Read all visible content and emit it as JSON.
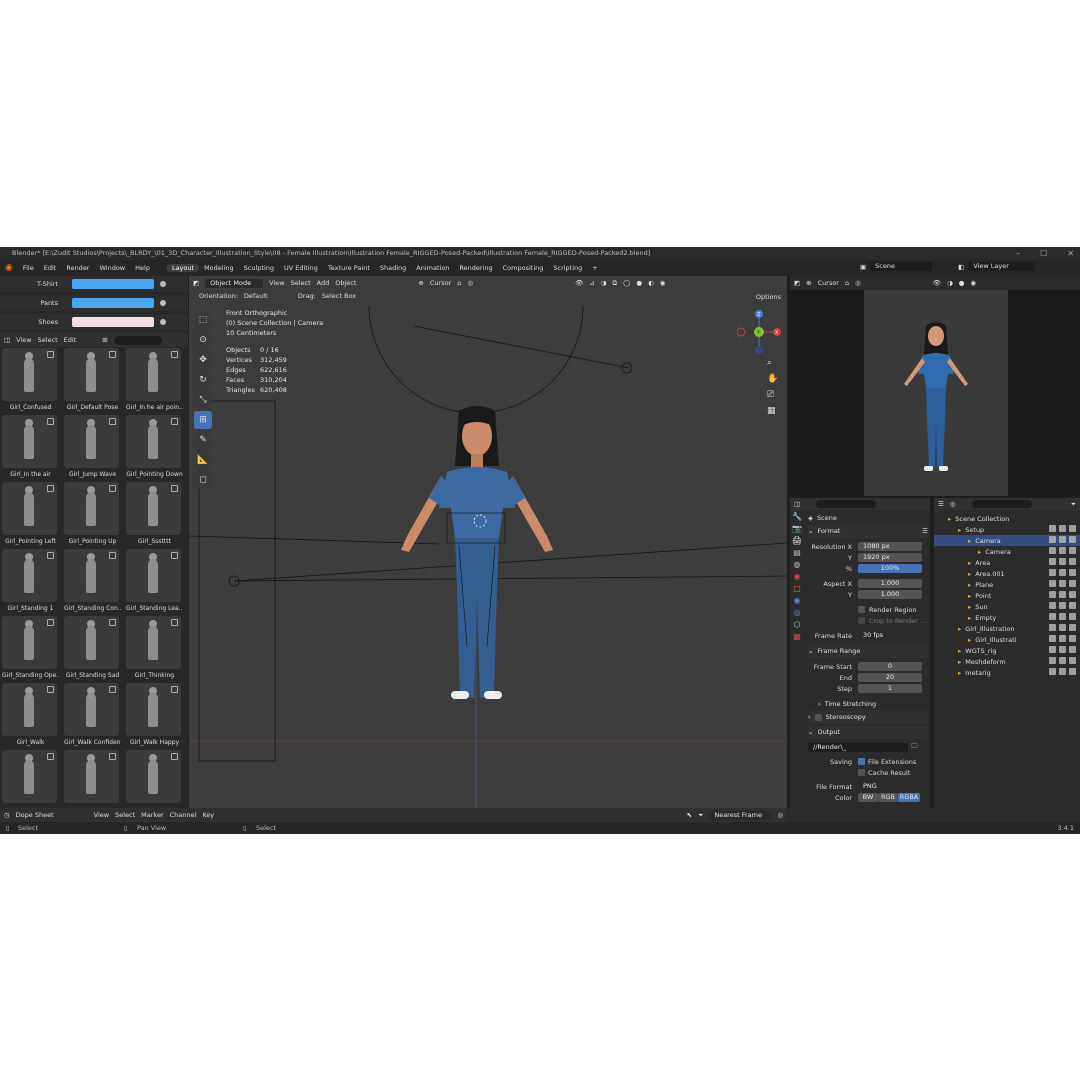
{
  "window": {
    "title": "Blender* [E:\\Zudit Studios\\Projects\\_BLRDY_\\01_3D_Character_Illustration_Style\\08 - Female Illustration\\Illustration Female_RIGGED-Posed-Packed\\Illustration Female_RIGGED-Posed-Packed2.blend]"
  },
  "menu": [
    "File",
    "Edit",
    "Render",
    "Window",
    "Help"
  ],
  "workspaces": [
    "Layout",
    "Modeling",
    "Sculpting",
    "UV Editing",
    "Texture Paint",
    "Shading",
    "Animation",
    "Rendering",
    "Compositing",
    "Scripting"
  ],
  "active_workspace": "Layout",
  "scene_selector": "Scene",
  "view_layer": "View Layer",
  "swatches": [
    {
      "label": "T-Shirt",
      "color": "#4aa6f0"
    },
    {
      "label": "Pants",
      "color": "#4aa6f0"
    },
    {
      "label": "Shoes",
      "color": "#f6dfe3"
    }
  ],
  "asset_browser": {
    "menu": [
      "View",
      "Select",
      "Edit"
    ],
    "items": [
      "Girl_Confused",
      "Girl_Default Pose",
      "Girl_In he air poin...",
      "Girl_In the air",
      "Girl_Jump Wave",
      "Girl_Pointing Down",
      "Girl_Pointing Left",
      "Girl_Pointing Up",
      "Girl_Ssstttt",
      "Girl_Standing 1",
      "Girl_Standing Con...",
      "Girl_Standing Lea...",
      "Girl_Standing Ope...",
      "Girl_Standing Sad",
      "Girl_Thinking",
      "Girl_Walk",
      "Girl_Walk Confident",
      "Girl_Walk Happy",
      "",
      "",
      ""
    ]
  },
  "viewport": {
    "mode": "Object Mode",
    "menu": [
      "View",
      "Select",
      "Add",
      "Object"
    ],
    "transform": "Cursor",
    "orientation_label": "Orientation:",
    "orientation": "Default",
    "drag_label": "Drag:",
    "drag": "Select Box",
    "options": "Options",
    "view_name": "Front Orthographic",
    "collection": "(0) Scene Collection | Camera",
    "scale": "10 Centimeters",
    "stats": [
      {
        "k": "Objects",
        "v": "0 / 16"
      },
      {
        "k": "Vertices",
        "v": "312,459"
      },
      {
        "k": "Edges",
        "v": "622,616"
      },
      {
        "k": "Faces",
        "v": "310,204"
      },
      {
        "k": "Triangles",
        "v": "620,408"
      }
    ],
    "gizmo": {
      "x": "X",
      "y": "Y",
      "z": "Z"
    }
  },
  "camera_view": {
    "transform": "Cursor"
  },
  "properties": {
    "scene": "Scene",
    "format_title": "Format",
    "res_x_label": "Resolution X",
    "res_x": "1080 px",
    "res_y_label": "Y",
    "res_y": "1920 px",
    "pct_label": "%",
    "pct": "100%",
    "aspect_x_label": "Aspect X",
    "aspect_x": "1.000",
    "aspect_y_label": "Y",
    "aspect_y": "1.000",
    "render_region": "Render Region",
    "crop": "Crop to Render ...",
    "frame_rate_label": "Frame Rate",
    "frame_rate": "30 fps",
    "frame_range_title": "Frame Range",
    "frame_start_label": "Frame Start",
    "frame_start": "0",
    "end_label": "End",
    "end": "20",
    "step_label": "Step",
    "step": "1",
    "time_stretching": "Time Stretching",
    "stereoscopy": "Stereoscopy",
    "output_title": "Output",
    "output_path": "//Render\\_",
    "saving_label": "Saving",
    "file_ext": "File Extensions",
    "cache": "Cache Result",
    "file_format_label": "File Format",
    "file_format": "PNG",
    "color_label": "Color",
    "color_opts": [
      "BW",
      "RGB",
      "RGBA"
    ]
  },
  "outliner": {
    "items": [
      {
        "name": "Scene Collection",
        "indent": 0,
        "sel": false
      },
      {
        "name": "Setup",
        "indent": 1,
        "sel": false
      },
      {
        "name": "Camera",
        "indent": 2,
        "sel": true
      },
      {
        "name": "Camera",
        "indent": 3,
        "sel": false
      },
      {
        "name": "Area",
        "indent": 2,
        "sel": false
      },
      {
        "name": "Area.001",
        "indent": 2,
        "sel": false
      },
      {
        "name": "Plane",
        "indent": 2,
        "sel": false
      },
      {
        "name": "Point",
        "indent": 2,
        "sel": false
      },
      {
        "name": "Sun",
        "indent": 2,
        "sel": false
      },
      {
        "name": "Empty",
        "indent": 2,
        "sel": false
      },
      {
        "name": "Girl_Illustration",
        "indent": 1,
        "sel": false
      },
      {
        "name": "Girl_Illustrati",
        "indent": 2,
        "sel": false
      },
      {
        "name": "WGTS_rig",
        "indent": 1,
        "sel": false
      },
      {
        "name": "Meshdeform",
        "indent": 1,
        "sel": false
      },
      {
        "name": "metarig",
        "indent": 1,
        "sel": false
      }
    ]
  },
  "dopesheet": {
    "mode": "Dope Sheet",
    "menu": [
      "View",
      "Select",
      "Marker",
      "Channel",
      "Key"
    ],
    "snap": "Nearest Frame"
  },
  "status": {
    "left": "Select",
    "mid": "Pan View",
    "right": "Select",
    "version": "3.4.1"
  }
}
